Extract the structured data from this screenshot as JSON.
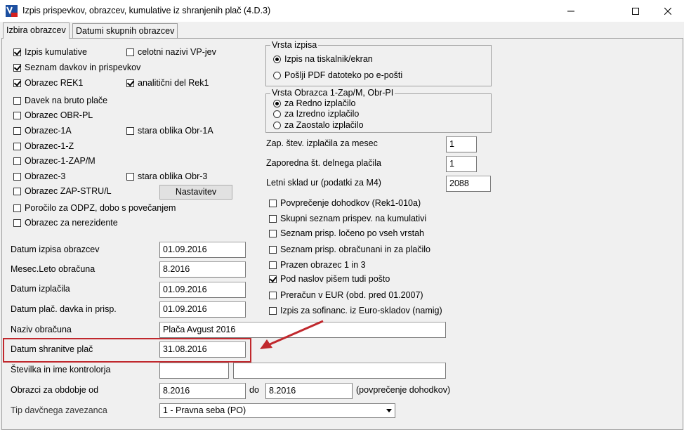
{
  "window": {
    "title": "Izpis prispevkov, obrazcev, kumulative iz shranjenih plač  (4.D.3)"
  },
  "tabs": [
    {
      "label": "Izbira obrazcev"
    },
    {
      "label": "Datumi skupnih obrazcev"
    }
  ],
  "checkboxes_left": [
    {
      "label": "Izpis kumulative",
      "checked": true
    },
    {
      "label": "Seznam davkov in prispevkov",
      "checked": true
    },
    {
      "label": "Obrazec REK1",
      "checked": true
    },
    {
      "label": "Davek na bruto plače",
      "checked": false
    },
    {
      "label": "Obrazec OBR-PL",
      "checked": false
    },
    {
      "label": "Obrazec-1A",
      "checked": false
    },
    {
      "label": "Obrazec-1-Z",
      "checked": false
    },
    {
      "label": "Obrazec-1-ZAP/M",
      "checked": false
    },
    {
      "label": "Obrazec-3",
      "checked": false
    },
    {
      "label": "Obrazec ZAP-STRU/L",
      "checked": false
    },
    {
      "label": "Poročilo za ODPZ, dobo s povečanjem",
      "checked": false
    },
    {
      "label": "Obrazec za nerezidente",
      "checked": false
    }
  ],
  "checkboxes_mid": [
    {
      "label": "celotni nazivi VP-jev",
      "checked": false
    },
    {
      "label": "analitični del Rek1",
      "checked": true
    },
    {
      "label": "stara oblika Obr-1A",
      "checked": false
    },
    {
      "label": "stara oblika Obr-3",
      "checked": false
    }
  ],
  "settings_button": "Nastavitev",
  "vrsta_izpisa": {
    "title": "Vrsta izpisa",
    "options": [
      "Izpis na tiskalnik/ekran",
      "Pošlji PDF datoteko po e-pošti"
    ]
  },
  "vrsta_obrazca": {
    "title": "Vrsta  Obrazca 1-Zap/M, Obr-PI",
    "options": [
      "za Redno izplačilo",
      "za Izredno izplačilo",
      "za Zaostalo izplačilo"
    ]
  },
  "right_fields": [
    {
      "label": "Zap. štev. izplačila za mesec",
      "value": "1"
    },
    {
      "label": "Zaporedna št. delnega plačila",
      "value": "1"
    },
    {
      "label": "Letni sklad ur (podatki za M4)",
      "value": "2088"
    }
  ],
  "checkboxes_right": [
    {
      "label": "Povprečenje dohodkov (Rek1-010a)",
      "checked": false
    },
    {
      "label": "Skupni seznam prispev. na kumulativi",
      "checked": false
    },
    {
      "label": "Seznam prisp. ločeno po vseh vrstah",
      "checked": false
    },
    {
      "label": "Seznam prisp. obračunani in za plačilo",
      "checked": false
    },
    {
      "label": "Prazen obrazec 1 in 3",
      "checked": false
    },
    {
      "label": "Pod naslov pišem tudi pošto",
      "checked": true
    },
    {
      "label": "Preračun v EUR (obd. pred 01.2007)",
      "checked": false
    },
    {
      "label": "Izpis za sofinanc. iz Euro-skladov (namig)",
      "checked": false
    }
  ],
  "form": {
    "datum_izpisa": {
      "label": "Datum izpisa obrazcev",
      "value": "01.09.2016"
    },
    "mesec_leto": {
      "label": "Mesec.Leto obračuna",
      "value": "8.2016"
    },
    "datum_izplacila": {
      "label": "Datum izplačila",
      "value": "01.09.2016"
    },
    "datum_plac_davka": {
      "label": "Datum plač. davka in prisp.",
      "value": "01.09.2016"
    },
    "naziv_obracuna": {
      "label": "Naziv obračuna",
      "value": "Plača Avgust 2016"
    },
    "datum_shranitve": {
      "label": "Datum shranitve plač",
      "value": "31.08.2016"
    },
    "kontrolor": {
      "label": "Številka in ime kontrolorja",
      "number": "",
      "name": ""
    },
    "obdobje": {
      "label": "Obrazci za obdobje od",
      "from": "8.2016",
      "to_label": "do",
      "to": "8.2016",
      "note": "(povprečenje dohodkov)"
    },
    "tip_zavezanca": {
      "label": "Tip davčnega zavezanca",
      "value": "1 - Pravna seba (PO)"
    }
  },
  "colors": {
    "highlight": "#c0282d",
    "arrow": "#c0282d",
    "window_bg": "#f0f0f0"
  }
}
